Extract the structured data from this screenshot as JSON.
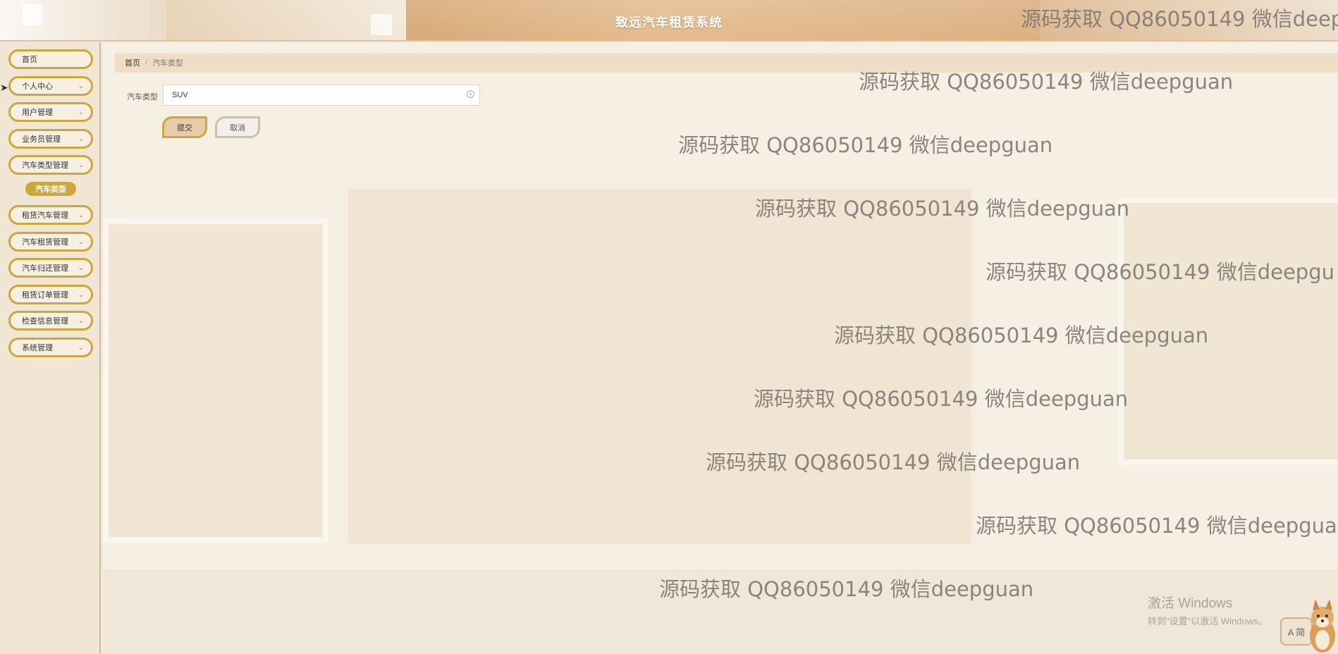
{
  "header": {
    "title": "致远汽车租赁系统"
  },
  "sidebar": {
    "items": [
      {
        "label": "首页",
        "has_arrow": false
      },
      {
        "label": "个人中心",
        "has_arrow": true
      },
      {
        "label": "用户管理",
        "has_arrow": true
      },
      {
        "label": "业务员管理",
        "has_arrow": true
      },
      {
        "label": "汽车类型管理",
        "has_arrow": true
      },
      {
        "label": "租赁汽车管理",
        "has_arrow": true
      },
      {
        "label": "汽车租赁管理",
        "has_arrow": true
      },
      {
        "label": "汽车归还管理",
        "has_arrow": true
      },
      {
        "label": "租赁订单管理",
        "has_arrow": true
      },
      {
        "label": "检查信息管理",
        "has_arrow": true
      },
      {
        "label": "系统管理",
        "has_arrow": true
      }
    ],
    "active_sub_item": "汽车类型"
  },
  "breadcrumb": {
    "home": "首页",
    "separator": "/",
    "current": "汽车类型"
  },
  "form": {
    "field_label": "汽车类型",
    "field_value": "SUV",
    "submit_label": "提交",
    "cancel_label": "取消"
  },
  "watermarks": [
    "源码获取 QQ86050149 微信deep",
    "源码获取 QQ86050149 微信deepguan",
    "源码获取 QQ86050149 微信deepguan",
    "源码获取 QQ86050149 微信deepguan",
    "源码获取 QQ86050149 微信deepgu",
    "源码获取 QQ86050149 微信deepguan",
    "源码获取 QQ86050149 微信deepguan",
    "源码获取 QQ86050149 微信deepguan",
    "源码获取 QQ86050149 微信deepgua",
    "源码获取 QQ86050149 微信deepguan"
  ],
  "windows_activation": {
    "line1": "激活 Windows",
    "line2": "转到\"设置\"以激活 Windows。"
  },
  "ime_indicator": "A 简",
  "colors": {
    "accent_gold": "#c9a83c",
    "sidebar_bg": "#f1e5d3",
    "breadcrumb_bg": "#eedec6"
  }
}
